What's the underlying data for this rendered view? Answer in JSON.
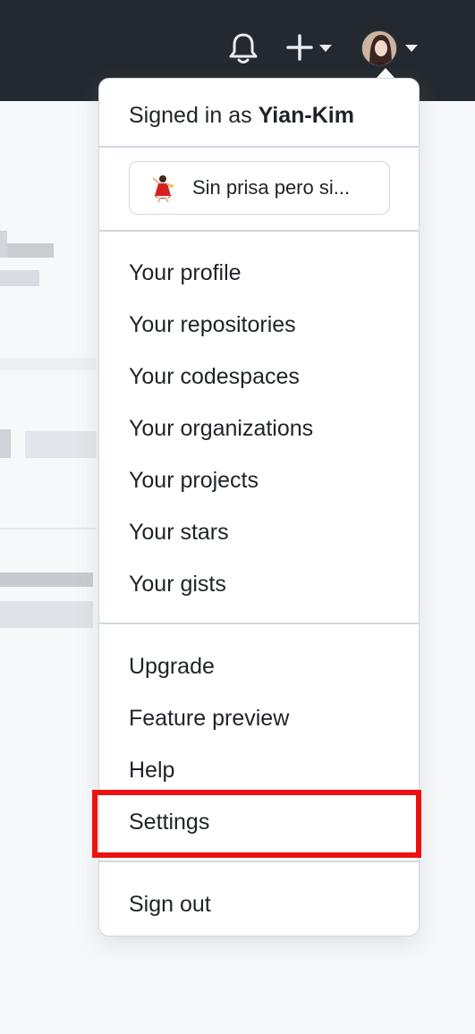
{
  "header": {
    "bell_icon": "bell-icon",
    "new_icon": "plus-icon",
    "avatar_icon": "user-avatar"
  },
  "menu": {
    "signed_in_prefix": "Signed in as",
    "username": "Yian-Kim",
    "status": {
      "emoji": "dancer-emoji",
      "text": "Sin prisa pero si..."
    },
    "group1": [
      "Your profile",
      "Your repositories",
      "Your codespaces",
      "Your organizations",
      "Your projects",
      "Your stars",
      "Your gists"
    ],
    "group2": [
      "Upgrade",
      "Feature preview",
      "Help",
      "Settings"
    ],
    "sign_out": "Sign out"
  },
  "colors": {
    "header_bg": "#24292f",
    "highlight": "#ee1111"
  }
}
